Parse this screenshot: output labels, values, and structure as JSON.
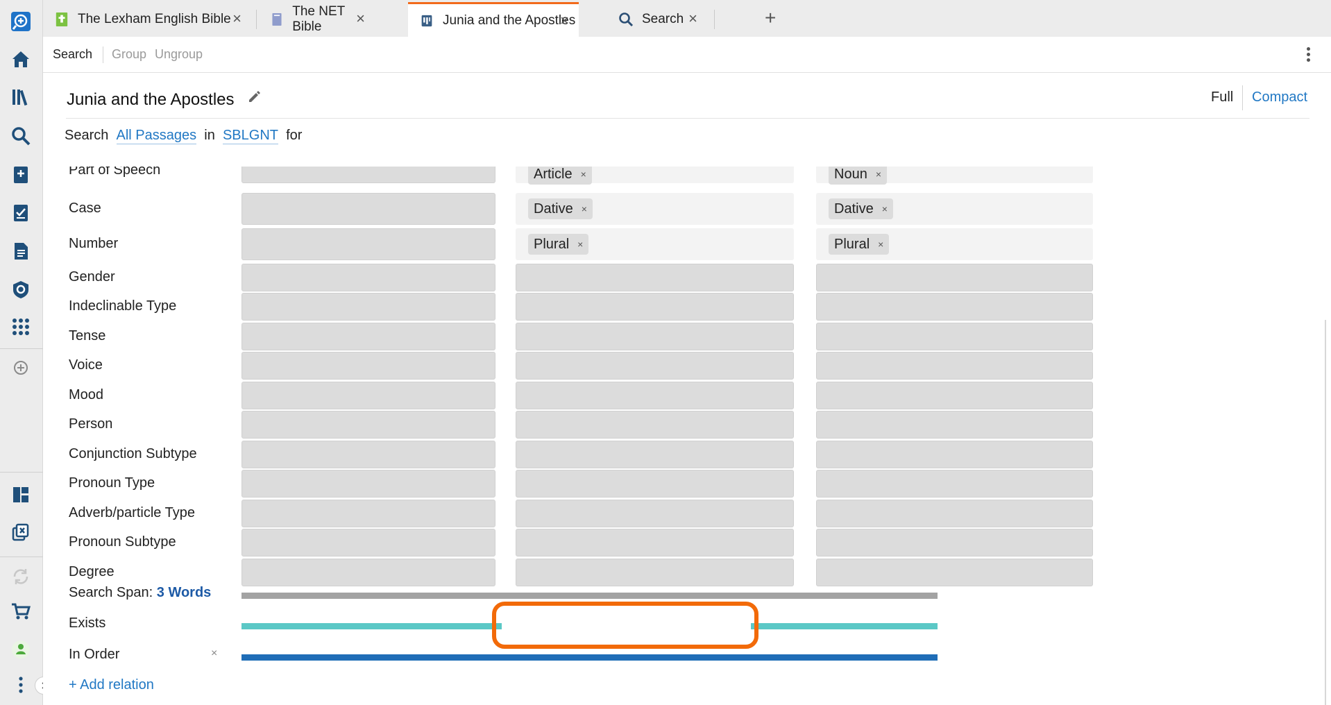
{
  "tabs": [
    {
      "label": "The Lexham English Bible",
      "icon": "lexham-book-icon",
      "icon_color": "#7cc242"
    },
    {
      "label": "The NET Bible",
      "icon": "net-book-icon",
      "icon_color": "#8f9ccc"
    },
    {
      "label": "Junia and the Apostles",
      "icon": "search-doc-icon",
      "active": true
    },
    {
      "label": "Search",
      "icon": "search-icon"
    }
  ],
  "toolbar": {
    "search": "Search",
    "group": "Group",
    "ungroup": "Ungroup"
  },
  "document": {
    "title": "Junia and the Apostles"
  },
  "view": {
    "full": "Full",
    "compact": "Compact"
  },
  "search_line": {
    "prefix": "Search",
    "passages": "All Passages",
    "in": "in",
    "version": "SBLGNT",
    "for": "for"
  },
  "grid": {
    "rows": [
      {
        "label": "Part of Speech",
        "cells": [
          "",
          "Article",
          "Noun"
        ]
      },
      {
        "label": "Case",
        "cells": [
          "",
          "Dative",
          "Dative"
        ]
      },
      {
        "label": "Number",
        "cells": [
          "",
          "Plural",
          "Plural"
        ]
      },
      {
        "label": "Gender",
        "cells": [
          "",
          "",
          ""
        ]
      },
      {
        "label": "Indeclinable Type",
        "cells": [
          "",
          "",
          ""
        ]
      },
      {
        "label": "Tense",
        "cells": [
          "",
          "",
          ""
        ]
      },
      {
        "label": "Voice",
        "cells": [
          "",
          "",
          ""
        ]
      },
      {
        "label": "Mood",
        "cells": [
          "",
          "",
          ""
        ]
      },
      {
        "label": "Person",
        "cells": [
          "",
          "",
          ""
        ]
      },
      {
        "label": "Conjunction Subtype",
        "cells": [
          "",
          "",
          ""
        ]
      },
      {
        "label": "Pronoun Type",
        "cells": [
          "",
          "",
          ""
        ]
      },
      {
        "label": "Adverb/particle Type",
        "cells": [
          "",
          "",
          ""
        ]
      },
      {
        "label": "Pronoun Subtype",
        "cells": [
          "",
          "",
          ""
        ]
      },
      {
        "label": "Degree",
        "cells": [
          "",
          "",
          ""
        ]
      }
    ],
    "chip_remove": "×"
  },
  "relations": {
    "span_label": "Search Span:",
    "span_value": "3 Words",
    "exists": "Exists",
    "in_order": "In Order",
    "remove": "×",
    "add": "+ Add relation"
  },
  "colors": {
    "accent": "#f26a1b",
    "link": "#2178c4",
    "exists_bar": "#5bc8c6",
    "in_order_bar": "#1f6db7",
    "span_bar": "#a3a3a3"
  }
}
